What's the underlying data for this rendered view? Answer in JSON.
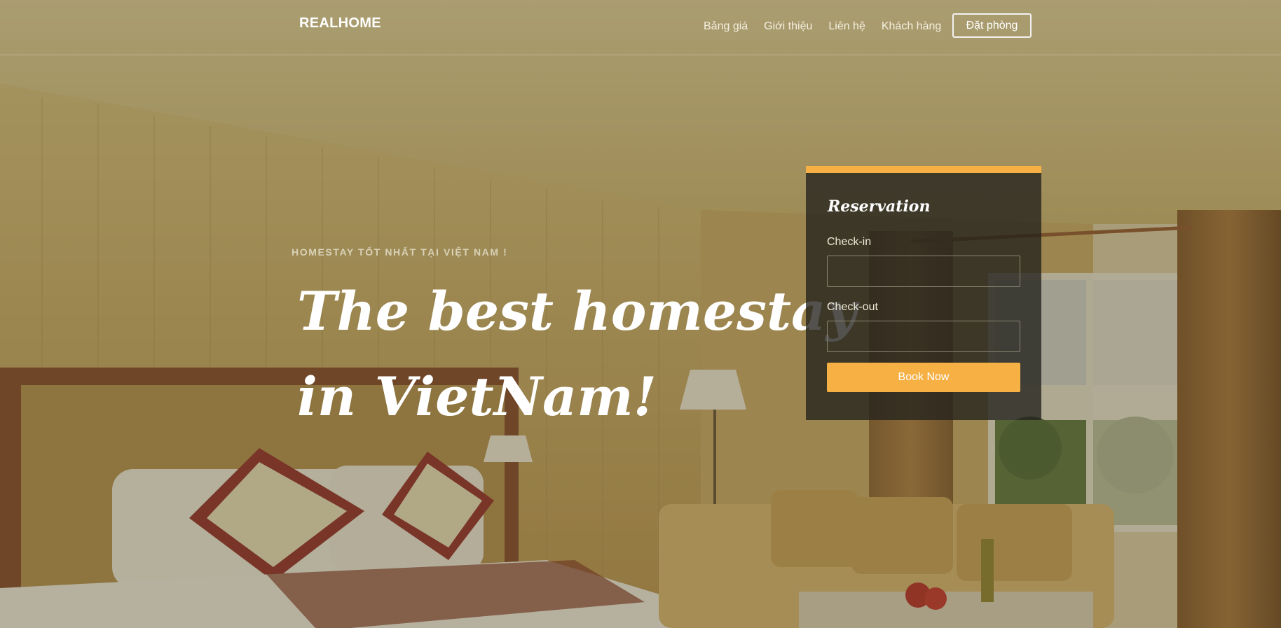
{
  "navbar": {
    "brand": "REALHOME",
    "links": [
      "Bảng giá",
      "Giới thiệu",
      "Liên hệ",
      "Khách hàng"
    ],
    "cta": "Đặt phòng"
  },
  "hero": {
    "subtitle": "HOMESTAY TỐT NHẤT TẠI VIỆT NAM !",
    "title_line1": "The best homestay",
    "title_line2": "in VietNam!"
  },
  "reservation": {
    "title": "Reservation",
    "checkin_label": "Check-in",
    "checkout_label": "Check-out",
    "book_button": "Book Now"
  },
  "colors": {
    "accent": "#f6b044",
    "card_bg": "#23211c",
    "text_light": "#ffffff"
  }
}
